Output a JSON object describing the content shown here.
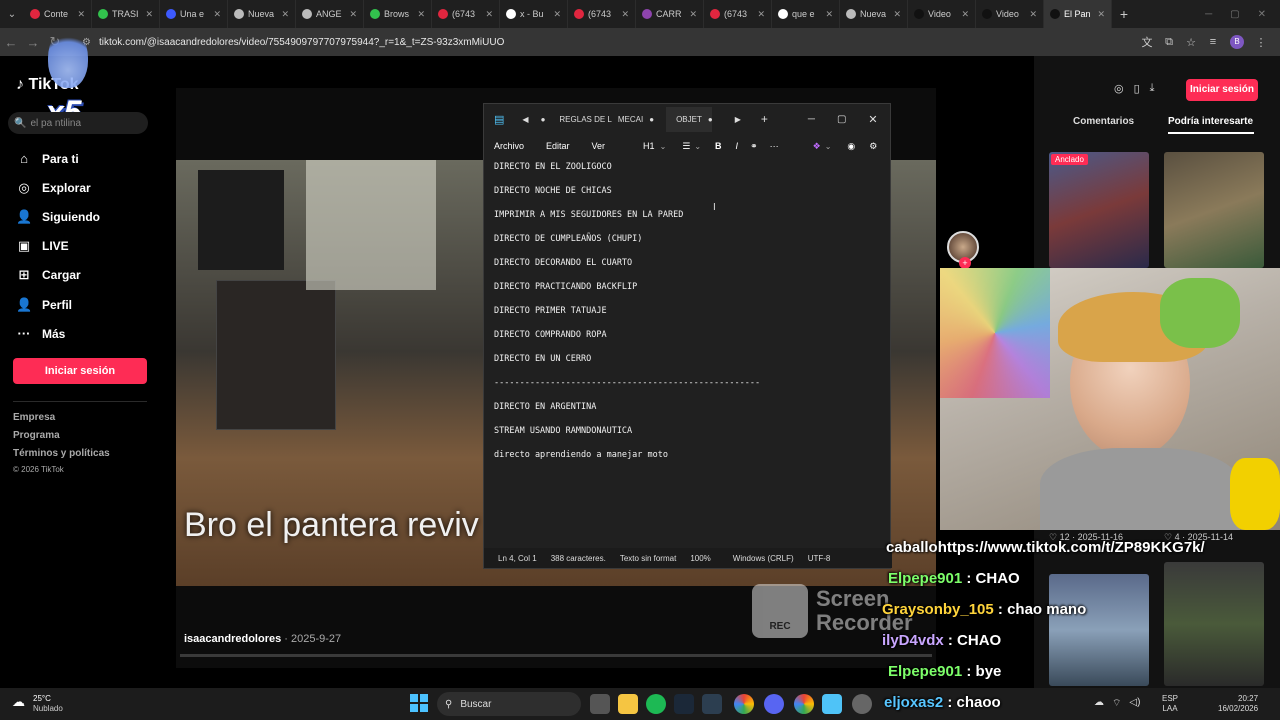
{
  "browser": {
    "tabs": [
      {
        "label": "Conte",
        "color": "#e0263f"
      },
      {
        "label": "TRASI",
        "color": "#32c24d"
      },
      {
        "label": "Una e",
        "color": "#3d5afe"
      },
      {
        "label": "Nueva",
        "color": "#bbbbbb"
      },
      {
        "label": "ANGE",
        "color": "#bbbbbb"
      },
      {
        "label": "Brows",
        "color": "#32c24d"
      },
      {
        "label": "(6743",
        "color": "#e0263f"
      },
      {
        "label": "x - Bu",
        "color": "#ffffff"
      },
      {
        "label": "(6743",
        "color": "#e0263f"
      },
      {
        "label": "CARR",
        "color": "#8e44ad"
      },
      {
        "label": "(6743",
        "color": "#e0263f"
      },
      {
        "label": "que e",
        "color": "#ffffff"
      },
      {
        "label": "Nueva",
        "color": "#bbbbbb"
      },
      {
        "label": "Video",
        "color": "#111111"
      },
      {
        "label": "Video",
        "color": "#111111"
      },
      {
        "label": "El Pan",
        "color": "#111111"
      }
    ],
    "url": "tiktok.com/@isaacandredolores/video/7554909797707975944?_r=1&_t=ZS-93z3xmMiUUO",
    "profile_initial": "B"
  },
  "sidebar": {
    "logo": "TikTok",
    "overlay_badge": "x5",
    "search_placeholder": "el pa   ntilina",
    "items": [
      {
        "label": "Para ti",
        "icon": "home-icon",
        "glyph": "⌂"
      },
      {
        "label": "Explorar",
        "icon": "compass-icon",
        "glyph": "◎"
      },
      {
        "label": "Siguiendo",
        "icon": "following-icon",
        "glyph": "👤"
      },
      {
        "label": "LIVE",
        "icon": "live-icon",
        "glyph": "▣"
      },
      {
        "label": "Cargar",
        "icon": "upload-icon",
        "glyph": "⊞"
      },
      {
        "label": "Perfil",
        "icon": "profile-icon",
        "glyph": "👤"
      },
      {
        "label": "Más",
        "icon": "more-icon",
        "glyph": "···"
      }
    ],
    "login_button": "Iniciar sesión",
    "footer": [
      "Empresa",
      "Programa",
      "Términos y políticas",
      "© 2026 TikTok"
    ]
  },
  "video": {
    "caption": "Bro el pantera reviv",
    "author": "isaacandredolores",
    "date": " · 2025-9-27"
  },
  "notepad": {
    "tabs": [
      "REGLAS DE L",
      "MECAI",
      "OBJET"
    ],
    "menu": [
      "Archivo",
      "Editar",
      "Ver"
    ],
    "heading_select": "H1",
    "lines": [
      "DIRECTO EN EL ZOOLIGOCO",
      "DIRECTO NOCHE DE CHICAS",
      "IMPRIMIR A MIS SEGUIDORES EN LA PARED",
      "DIRECTO DE CUMPLEAÑOS (CHUPI)",
      "DIRECTO DECORANDO EL CUARTO",
      "DIRECTO PRACTICANDO BACKFLIP",
      "DIRECTO PRIMER TATUAJE",
      "DIRECTO COMPRANDO ROPA",
      "DIRECTO EN UN CERRO",
      "----------------------------------------------------",
      "DIRECTO EN ARGENTINA",
      "STREAM USANDO RAMNDONAUTICA",
      "directo aprendiendo a manejar moto"
    ],
    "status": {
      "position": "Ln 4, Col 1",
      "chars": "388 caracteres.",
      "format": "Texto sin format",
      "zoom": "100%",
      "eol": "Windows (CRLF)",
      "encoding": "UTF-8"
    }
  },
  "right_panel": {
    "login_button": "Iniciar sesión",
    "tabs": [
      "Comentarios",
      "Podría interesarte"
    ],
    "pinned_badge": "Anclado",
    "stats": [
      {
        "likes": "12",
        "date": "2025-11-16"
      },
      {
        "likes": "4",
        "date": "2025-11-14"
      }
    ]
  },
  "chat": [
    {
      "user": "caballo",
      "message": "https://www.tiktok.com/t/ZP89KKG7k/",
      "user_color": "#ffffff"
    },
    {
      "user": "Elpepe901",
      "message": " : CHAO",
      "user_color": "#7dff6a"
    },
    {
      "user": "Graysonby_105",
      "message": " : chao mano",
      "user_color": "#ffd43b"
    },
    {
      "user": "ilyD4vdx",
      "message": " : CHAO",
      "user_color": "#c9a6ff"
    },
    {
      "user": "Elpepe901",
      "message": " : bye",
      "user_color": "#7dff6a"
    },
    {
      "user": "eljoxas2",
      "message": " : chaoo",
      "user_color": "#58c6ff"
    }
  ],
  "recorder": {
    "badge": "REC",
    "line1": "Screen",
    "line2": "Recorder"
  },
  "taskbar": {
    "temperature": "25°C",
    "weather": "Nublado",
    "search": "Buscar",
    "language": "ESP",
    "region": "LAA",
    "time": "20:27",
    "date": "16/02/2026"
  }
}
